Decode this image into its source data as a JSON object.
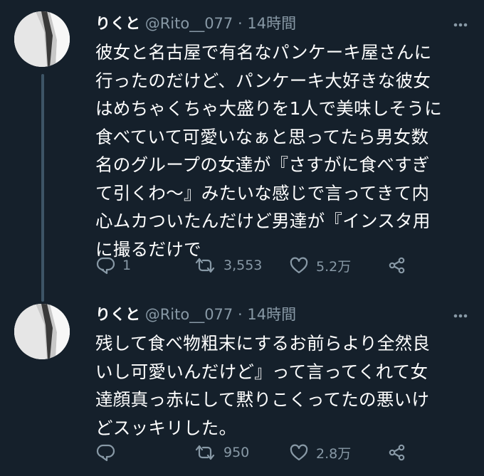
{
  "tweets": [
    {
      "name": "りくと",
      "handle": "@Rito__077",
      "dot": "·",
      "time": "14時間",
      "text": "彼女と名古屋で有名なパンケーキ屋さんに\n行ったのだけど、パンケーキ大好きな彼女\nはめちゃくちゃ大盛りを1人で美味しそうに\n食べていて可愛いなぁと思ってたら男女数\n名のグループの女達が『さすがに食べすぎ\nて引くわ〜』みたいな感じで言ってきて内\n心ムカついたんだけど男達が『インスタ用\nに撮るだけで",
      "replies": "1",
      "retweets": "3,553",
      "likes": "5.2万"
    },
    {
      "name": "りくと",
      "handle": "@Rito__077",
      "dot": "·",
      "time": "14時間",
      "text": "残して食べ物粗末にするお前らより全然良\nいし可愛いんだけど』って言ってくれて女\n達顔真っ赤にして黙りこくってたの悪いけ\nどスッキリした。",
      "replies": "",
      "retweets": "950",
      "likes": "2.8万"
    }
  ],
  "icons": {
    "reply": "reply-icon",
    "retweet": "retweet-icon",
    "like": "heart-icon",
    "share": "share-icon",
    "more": "more-icon"
  },
  "colors": {
    "background": "#15202b",
    "text": "#ffffff",
    "secondary": "#8899a6",
    "thread_line": "#3d5466"
  }
}
